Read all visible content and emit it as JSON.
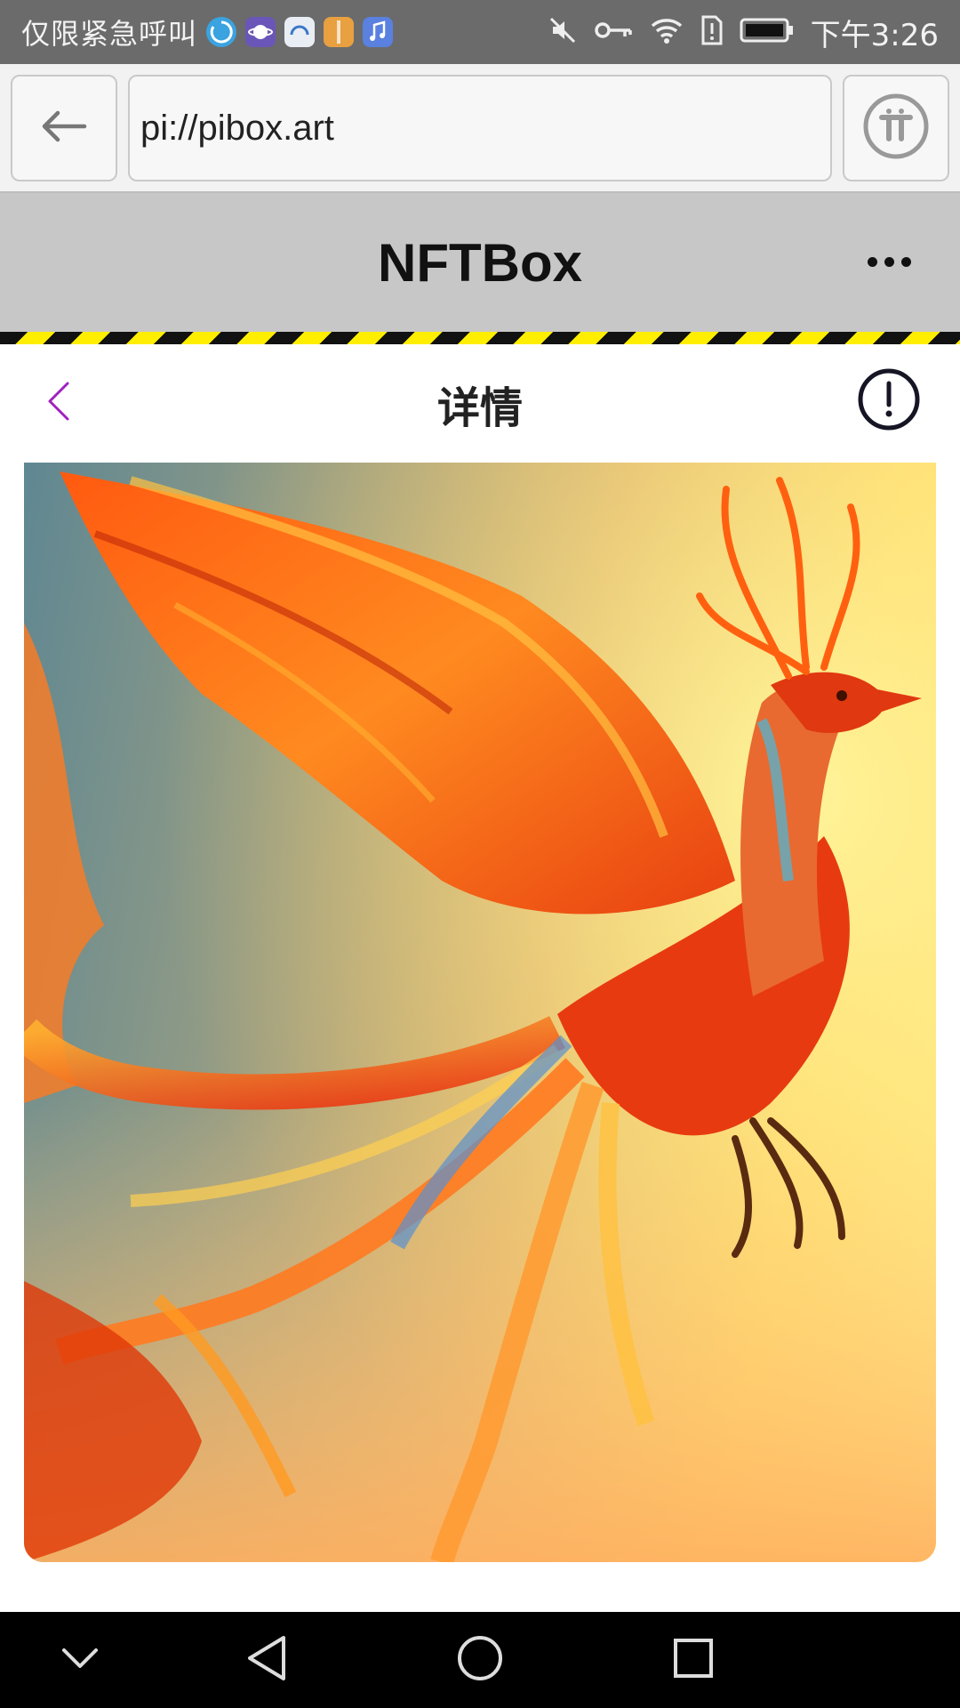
{
  "status_bar": {
    "carrier_text": "仅限紧急呼叫",
    "app_icons": [
      "swirl-app-icon",
      "planet-app-icon",
      "headset-app-icon",
      "zipper-app-icon",
      "music-app-icon"
    ],
    "status_icons": [
      "mute-icon",
      "key-icon",
      "wifi-icon",
      "sim-alert-icon",
      "battery-icon"
    ],
    "time": "下午3:26"
  },
  "browser": {
    "url": "pi://pibox.art"
  },
  "app_header": {
    "title": "NFTBox"
  },
  "detail": {
    "title": "详情"
  },
  "nft": {
    "subject": "phoenix-artwork"
  },
  "colors": {
    "status_bar": "#6b6b6b",
    "header_bg": "#c7c7c7",
    "hazard_yellow": "#ffee00",
    "back_chevron": "#a020c0",
    "nav_bar": "#000000"
  }
}
